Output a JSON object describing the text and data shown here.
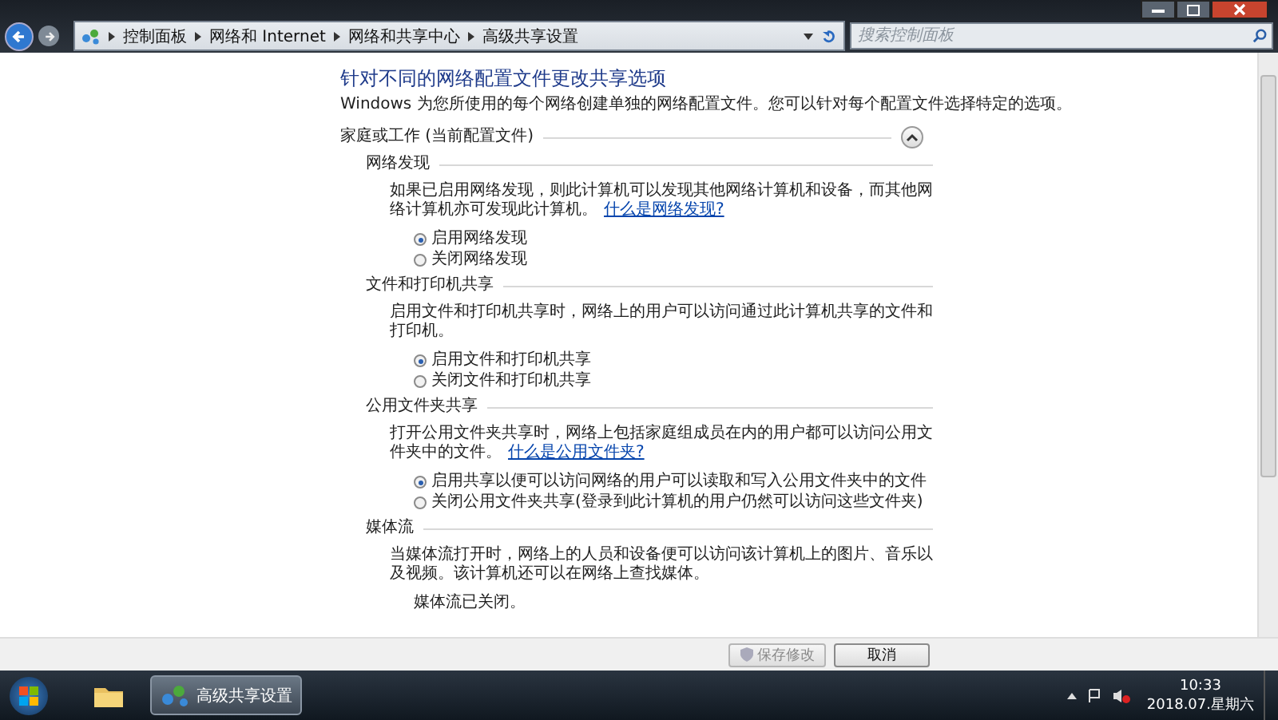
{
  "address_bar": {
    "breadcrumbs": [
      "控制面板",
      "网络和 Internet",
      "网络和共享中心",
      "高级共享设置"
    ]
  },
  "search": {
    "placeholder": "搜索控制面板"
  },
  "page": {
    "title": "针对不同的网络配置文件更改共享选项",
    "description": "Windows 为您所使用的每个网络创建单独的网络配置文件。您可以针对每个配置文件选择特定的选项。",
    "profile": {
      "label": "家庭或工作 (当前配置文件)",
      "expanded": true
    },
    "sections": [
      {
        "title": "网络发现",
        "text": "如果已启用网络发现，则此计算机可以发现其他网络计算机和设备，而其他网络计算机亦可发现此计算机。",
        "link": "什么是网络发现?",
        "options": [
          {
            "label": "启用网络发现",
            "selected": true
          },
          {
            "label": "关闭网络发现",
            "selected": false
          }
        ]
      },
      {
        "title": "文件和打印机共享",
        "text": "启用文件和打印机共享时，网络上的用户可以访问通过此计算机共享的文件和打印机。",
        "options": [
          {
            "label": "启用文件和打印机共享",
            "selected": true
          },
          {
            "label": "关闭文件和打印机共享",
            "selected": false
          }
        ]
      },
      {
        "title": "公用文件夹共享",
        "text": "打开公用文件夹共享时，网络上包括家庭组成员在内的用户都可以访问公用文件夹中的文件。",
        "link": "什么是公用文件夹?",
        "options": [
          {
            "label": "启用共享以便可以访问网络的用户可以读取和写入公用文件夹中的文件",
            "selected": true
          },
          {
            "label": "关闭公用文件夹共享(登录到此计算机的用户仍然可以访问这些文件夹)",
            "selected": false
          }
        ]
      },
      {
        "title": "媒体流",
        "text": "当媒体流打开时，网络上的人员和设备便可以访问该计算机上的图片、音乐以及视频。该计算机还可以在网络上查找媒体。",
        "status": "媒体流已关闭。"
      }
    ]
  },
  "buttons": [
    {
      "label": "保存修改",
      "kind": "shield",
      "disabled": true
    },
    {
      "label": "取消",
      "kind": "plain",
      "disabled": false
    }
  ],
  "taskbar": {
    "window_button": "高级共享设置",
    "clock": {
      "time": "10:33",
      "date": "2018.07.星期六"
    }
  }
}
